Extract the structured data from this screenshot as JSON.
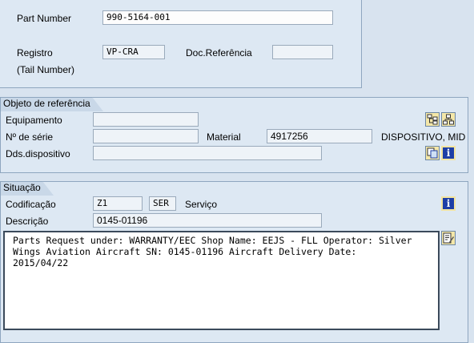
{
  "header": {
    "part_number_label": "Part Number",
    "part_number_value": "990-5164-001",
    "registro_label": "Registro",
    "registro_value": "VP-CRA",
    "tail_number_label": "(Tail Number)",
    "doc_ref_label": "Doc.Referência",
    "doc_ref_value": ""
  },
  "objeto": {
    "tab_label": "Objeto de referência",
    "equipamento_label": "Equipamento",
    "equipamento_value": "",
    "serie_label": "Nº de série",
    "serie_value": "",
    "material_label": "Material",
    "material_value": "4917256",
    "material_desc": "DISPOSITIVO, MID",
    "dds_label": "Dds.dispositivo",
    "dds_value": ""
  },
  "situacao": {
    "tab_label": "Situação",
    "codificacao_label": "Codificação",
    "codificacao_value": "Z1",
    "codificacao_code": "SER",
    "codificacao_text": "Serviço",
    "descricao_label": "Descrição",
    "descricao_value": "0145-01196",
    "long_text": "Parts Request under: WARRANTY/EEC Shop Name: EEJS - FLL Operator: Silver\nWings Aviation Aircraft SN: 0145-01196 Aircraft Delivery Date:\n2015/04/22"
  },
  "icons": {
    "hierarchy_icon": "hierarchy-structure-icon",
    "structure_icon": "structure-tree-icon",
    "copy_icon": "copy-display-icon",
    "info_icon": "info-icon",
    "edit_text_icon": "edit-text-icon",
    "info_glyph": "i"
  }
}
